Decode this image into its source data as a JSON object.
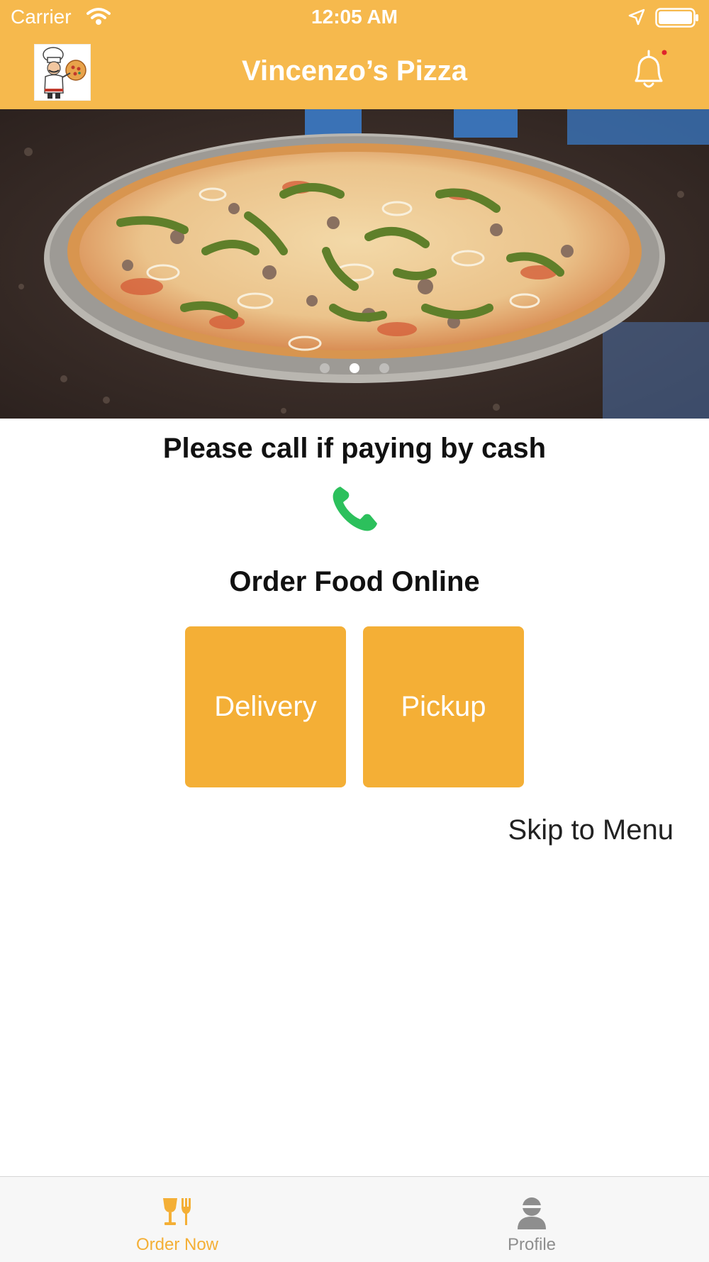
{
  "status_bar": {
    "carrier": "Carrier",
    "time": "12:05 AM",
    "icons": [
      "wifi-icon",
      "location-arrow-icon",
      "battery-icon"
    ]
  },
  "nav": {
    "title": "Vincenzo’s Pizza",
    "logo_icon": "chef-pizza-logo",
    "right_icon": "bell-icon",
    "notification_dot_color": "#E0242B",
    "bar_color": "#F6B94D"
  },
  "hero": {
    "image": "pizza-photo",
    "carousel_page_count": 3,
    "carousel_active_index": 1
  },
  "main": {
    "cash_note": "Please call if paying by cash",
    "phone_icon": "phone-icon",
    "phone_icon_color": "#2CC05C",
    "order_heading": "Order Food Online",
    "buttons": {
      "delivery": "Delivery",
      "pickup": "Pickup",
      "color": "#F4AF36"
    },
    "skip_link": "Skip to Menu"
  },
  "tab_bar": {
    "tabs": [
      {
        "label": "Order Now",
        "icon": "order-now-icon",
        "active": true
      },
      {
        "label": "Profile",
        "icon": "profile-icon",
        "active": false
      }
    ],
    "active_color": "#F4AF36",
    "inactive_color": "#8E8E8E"
  }
}
